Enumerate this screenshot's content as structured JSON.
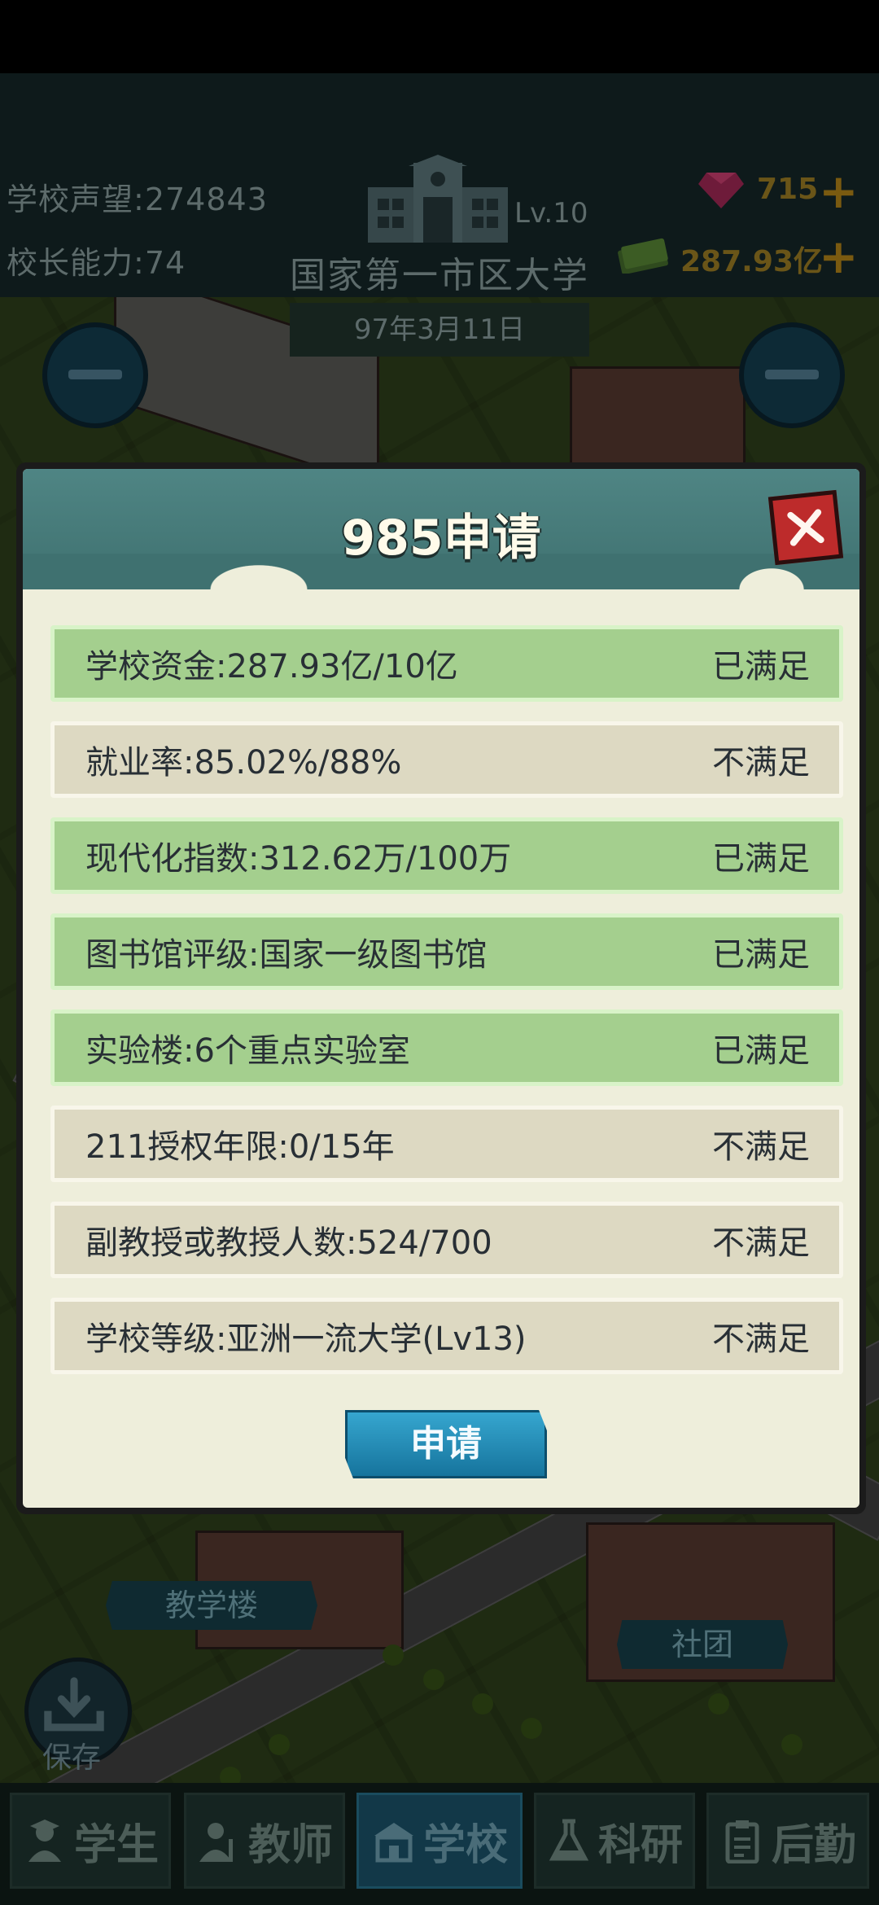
{
  "top_stats": {
    "reputation_label": "学校声望:",
    "reputation_value": "274843",
    "principal_label": "校长能力:",
    "principal_value": "74"
  },
  "school": {
    "level": "Lv.10",
    "name": "国家第一市区大学",
    "date": "97年3月11日"
  },
  "resources": {
    "gems": "715",
    "money": "287.93亿",
    "plus_symbol": "+"
  },
  "map_labels": {
    "teaching_building": "教学楼",
    "club": "社团"
  },
  "save_label": "保存",
  "nav": {
    "tabs": [
      {
        "label": "学生",
        "icon": "student-icon"
      },
      {
        "label": "教师",
        "icon": "teacher-icon"
      },
      {
        "label": "学校",
        "icon": "school-icon",
        "active": true
      },
      {
        "label": "科研",
        "icon": "flask-icon"
      },
      {
        "label": "后勤",
        "icon": "clipboard-icon"
      }
    ]
  },
  "dialog": {
    "title": "985申请",
    "apply_label": "申请",
    "requirements": [
      {
        "text": "学校资金:287.93亿/10亿",
        "status": "已满足",
        "met": true
      },
      {
        "text": "就业率:85.02%/88%",
        "status": "不满足",
        "met": false
      },
      {
        "text": "现代化指数:312.62万/100万",
        "status": "已满足",
        "met": true
      },
      {
        "text": "图书馆评级:国家一级图书馆",
        "status": "已满足",
        "met": true
      },
      {
        "text": "实验楼:6个重点实验室",
        "status": "已满足",
        "met": true
      },
      {
        "text": "211授权年限:0/15年",
        "status": "不满足",
        "met": false
      },
      {
        "text": "副教授或教授人数:524/700",
        "status": "不满足",
        "met": false
      },
      {
        "text": "学校等级:亚洲一流大学(Lv13)",
        "status": "不满足",
        "met": false
      }
    ]
  },
  "colors": {
    "met_row": "#a4cf8e",
    "unmet_row": "#ddd9c2",
    "header_teal": "#4f8584",
    "close_red": "#bd2b2b",
    "apply_blue": "#1f8bb6"
  }
}
